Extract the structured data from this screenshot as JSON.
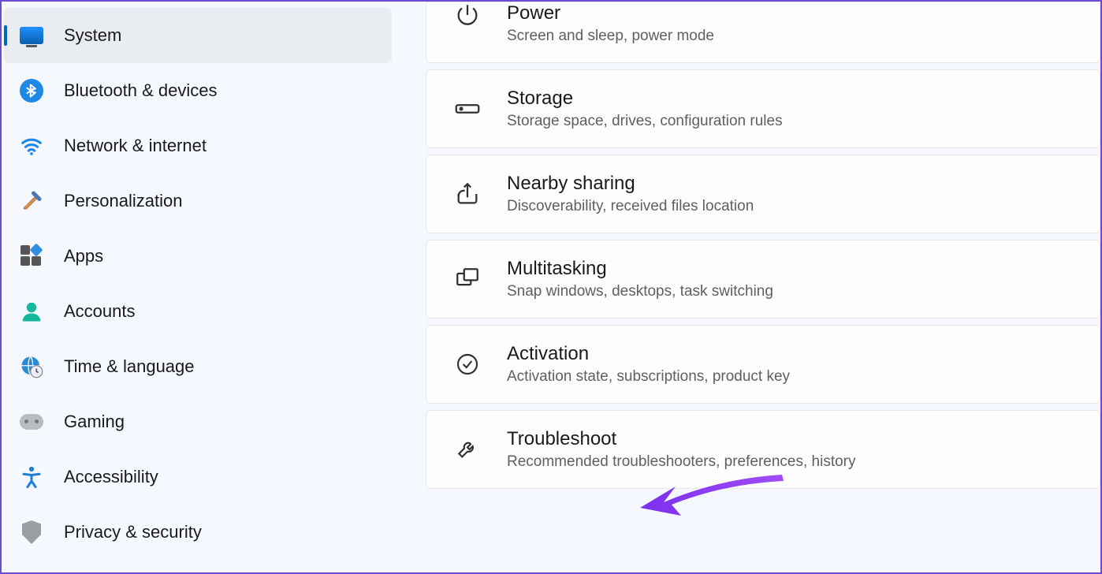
{
  "sidebar": {
    "items": [
      {
        "label": "System"
      },
      {
        "label": "Bluetooth & devices"
      },
      {
        "label": "Network & internet"
      },
      {
        "label": "Personalization"
      },
      {
        "label": "Apps"
      },
      {
        "label": "Accounts"
      },
      {
        "label": "Time & language"
      },
      {
        "label": "Gaming"
      },
      {
        "label": "Accessibility"
      },
      {
        "label": "Privacy & security"
      }
    ]
  },
  "main": {
    "cards": [
      {
        "title": "Power",
        "sub": "Screen and sleep, power mode"
      },
      {
        "title": "Storage",
        "sub": "Storage space, drives, configuration rules"
      },
      {
        "title": "Nearby sharing",
        "sub": "Discoverability, received files location"
      },
      {
        "title": "Multitasking",
        "sub": "Snap windows, desktops, task switching"
      },
      {
        "title": "Activation",
        "sub": "Activation state, subscriptions, product key"
      },
      {
        "title": "Troubleshoot",
        "sub": "Recommended troubleshooters, preferences, history"
      }
    ]
  }
}
